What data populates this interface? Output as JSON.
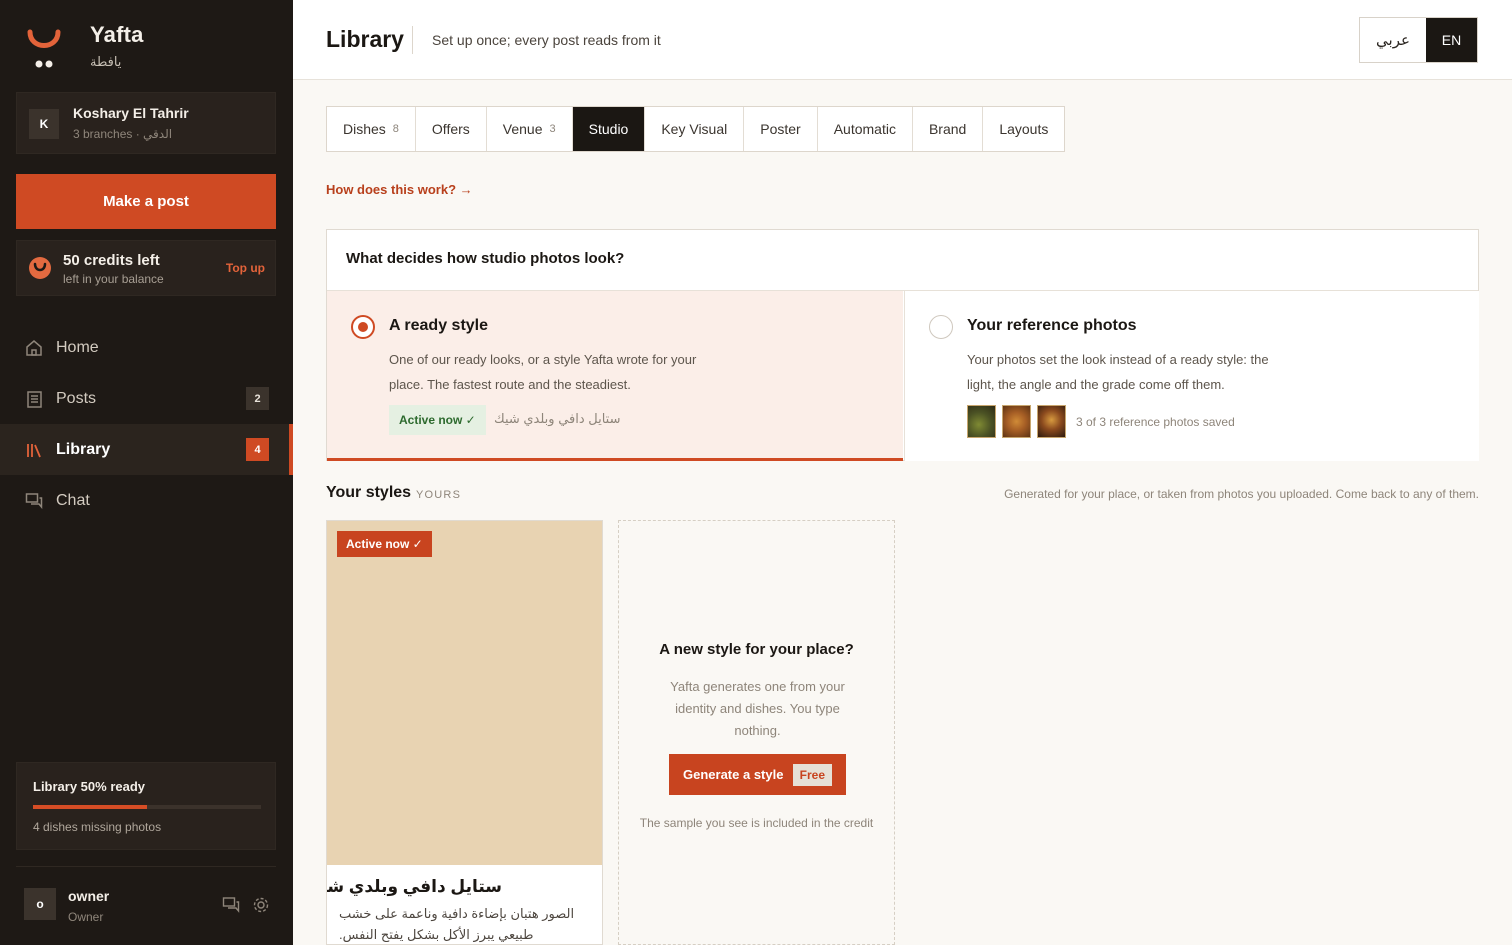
{
  "brand": {
    "name": "Yafta",
    "name_ar": "يافطة"
  },
  "venue": {
    "initial": "K",
    "name": "Koshary El Tahrir",
    "sub": "3 branches · الدقي"
  },
  "make_post": "Make a post",
  "credits": {
    "title": "50 credits left",
    "sub": "left in your balance",
    "topup": "Top up"
  },
  "nav": [
    {
      "label": "Home",
      "icon": "home-icon",
      "badge": ""
    },
    {
      "label": "Posts",
      "icon": "posts-icon",
      "badge": "2"
    },
    {
      "label": "Library",
      "icon": "library-icon",
      "badge": "4",
      "active": true
    },
    {
      "label": "Chat",
      "icon": "chat-icon",
      "badge": ""
    }
  ],
  "library_progress": {
    "title": "Library 50% ready",
    "fraction": 0.5,
    "sub": "4 dishes missing photos"
  },
  "user": {
    "initial": "o",
    "name": "owner",
    "role": "Owner"
  },
  "header": {
    "title": "Library",
    "subtitle": "Set up once; every post reads from it",
    "lang_ar": "عربي",
    "lang_en": "EN"
  },
  "tabs": [
    {
      "label": "Dishes",
      "count": "8"
    },
    {
      "label": "Offers",
      "count": ""
    },
    {
      "label": "Venue",
      "count": "3"
    },
    {
      "label": "Studio",
      "count": "",
      "active": true
    },
    {
      "label": "Key Visual",
      "count": ""
    },
    {
      "label": "Poster",
      "count": ""
    },
    {
      "label": "Automatic",
      "count": ""
    },
    {
      "label": "Brand",
      "count": ""
    },
    {
      "label": "Layouts",
      "count": ""
    }
  ],
  "how_link": "How does this work? →",
  "decide": {
    "question": "What decides how studio photos look?",
    "option_a": {
      "title": "A ready style",
      "desc": "One of our ready looks, or a style Yafta wrote for your place. The fastest route and the steadiest.",
      "chip": "Active now ✓",
      "style_name": "ستايل دافي وبلدي شيك"
    },
    "option_b": {
      "title": "Your reference photos",
      "desc": "Your photos set the look instead of a ready style: the light, the angle and the grade come off them.",
      "note": "3 of 3 reference photos saved"
    }
  },
  "styles": {
    "heading": "Your styles",
    "tag": "YOURS",
    "note": "Generated for your place, or taken from photos you uploaded. Come back to any of them.",
    "card": {
      "badge": "Active now ✓",
      "name": "ستايل دافي وبلدي شيك",
      "desc": "الصور هتبان بإضاءة دافية وناعمة على خشب طبيعي يبرز الأكل بشكل يفتح النفس.",
      "swatch_color": "#e8d3b2"
    },
    "new": {
      "title": "A new style for your place?",
      "desc": "Yafta generates one from your identity and dishes. You type nothing.",
      "button": "Generate a style",
      "free": "Free",
      "note": "The sample you see is included in the credit"
    }
  },
  "colors": {
    "accent": "#cf4a23",
    "sidebar": "#1e1915",
    "active_green": "#2d6a2e"
  }
}
